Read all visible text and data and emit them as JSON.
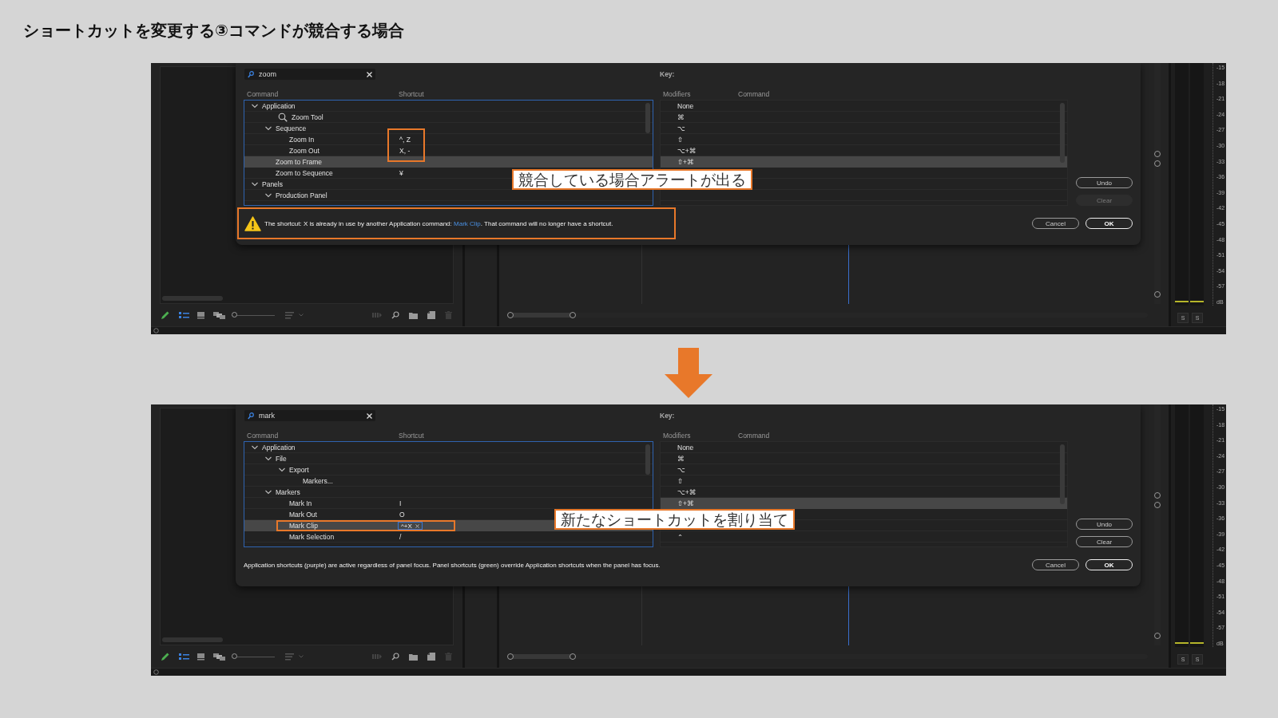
{
  "title": "ショートカットを変更する③コマンドが競合する場合",
  "screens": [
    {
      "search": "zoom",
      "key_label": "Key:",
      "command_columns": [
        "Command",
        "Shortcut"
      ],
      "modifier_columns": [
        "Modifiers",
        "Command"
      ],
      "commands": [
        {
          "label": "Application",
          "selected": false,
          "expanded": true,
          "children": [
            {
              "label": "Zoom Tool",
              "kind": "tool",
              "selected": false
            },
            {
              "label": "Sequence",
              "selected": false,
              "expanded": true,
              "children": [
                {
                  "label": "Zoom In",
                  "shortcut": "^, Z",
                  "shortcut_highlighted": true,
                  "selected": false
                },
                {
                  "label": "Zoom Out",
                  "shortcut": "X, -",
                  "shortcut_highlighted": true,
                  "selected": false
                }
              ]
            },
            {
              "label": "Zoom to Frame",
              "selected": true
            },
            {
              "label": "Zoom to Sequence",
              "shortcut": "¥",
              "selected": false
            }
          ]
        },
        {
          "label": "Panels",
          "selected": false,
          "expanded": true,
          "children": [
            {
              "label": "Production Panel",
              "selected": false,
              "expanded": true
            }
          ]
        }
      ],
      "modifiers": [
        {
          "kind": "modifier",
          "label": "None",
          "selected": false
        },
        {
          "kind": "modifier",
          "label": "⌘",
          "selected": false
        },
        {
          "kind": "modifier",
          "label": "⌥",
          "selected": false
        },
        {
          "kind": "modifier",
          "label": "⇧",
          "selected": false
        },
        {
          "kind": "modifier",
          "label": "⌥+⌘",
          "selected": false
        },
        {
          "kind": "modifier",
          "label": "⇧+⌘",
          "selected": true
        }
      ],
      "side_buttons": [
        {
          "label": "Undo",
          "disabled": false
        },
        {
          "label": "Clear",
          "disabled": true
        }
      ],
      "dialog_buttons": [
        {
          "label": "Cancel",
          "default": false
        },
        {
          "label": "OK",
          "default": true
        }
      ],
      "footer": {
        "kind": "alert",
        "text_before": "The shortcut: X is already in use by another Application command:  ",
        "link": "Mark Clip",
        "text_after": ". That command will no longer have a shortcut."
      },
      "callout": "競合している場合アラートが出る",
      "thumbnail_slider": {
        "level": 0
      },
      "meter_scale": [
        "-15",
        "-18",
        "-21",
        "-24",
        "-27",
        "-30",
        "-33",
        "-36",
        "-39",
        "-42",
        "-45",
        "-48",
        "-51",
        "-54",
        "-57",
        "dB"
      ],
      "meter_buttons": [
        "S",
        "S"
      ]
    },
    {
      "search": "mark",
      "key_label": "Key:",
      "command_columns": [
        "Command",
        "Shortcut"
      ],
      "modifier_columns": [
        "Modifiers",
        "Command"
      ],
      "commands": [
        {
          "label": "Application",
          "selected": false,
          "expanded": true,
          "children": [
            {
              "label": "File",
              "selected": false,
              "expanded": true,
              "children": [
                {
                  "label": "Export",
                  "selected": false,
                  "expanded": true,
                  "children": [
                    {
                      "label": "Markers...",
                      "selected": false
                    }
                  ]
                }
              ]
            },
            {
              "label": "Markers",
              "selected": false,
              "expanded": true,
              "children": [
                {
                  "label": "Mark In",
                  "shortcut": "I",
                  "selected": false
                },
                {
                  "label": "Mark Out",
                  "shortcut": "O",
                  "selected": false
                },
                {
                  "label": "Mark Clip",
                  "shortcut": "^+X",
                  "editing": true,
                  "row_highlighted": true,
                  "selected": true
                },
                {
                  "label": "Mark Selection",
                  "shortcut": "/",
                  "selected": false
                }
              ]
            }
          ]
        }
      ],
      "modifiers": [
        {
          "kind": "modifier",
          "label": "None",
          "selected": false
        },
        {
          "kind": "modifier",
          "label": "⌘",
          "selected": false
        },
        {
          "kind": "modifier",
          "label": "⌥",
          "selected": false
        },
        {
          "kind": "modifier",
          "label": "⇧",
          "selected": false
        },
        {
          "kind": "modifier",
          "label": "⌥+⌘",
          "selected": false
        },
        {
          "kind": "modifier",
          "label": "⇧+⌘",
          "selected": true
        },
        {
          "kind": "blank"
        },
        {
          "kind": "blank"
        },
        {
          "kind": "modifier",
          "label": "⌃",
          "selected": false
        }
      ],
      "side_buttons": [
        {
          "label": "Undo",
          "disabled": false
        },
        {
          "label": "Clear",
          "disabled": false
        }
      ],
      "dialog_buttons": [
        {
          "label": "Cancel",
          "default": false
        },
        {
          "label": "OK",
          "default": true
        }
      ],
      "footer": {
        "kind": "info",
        "text": "Application shortcuts (purple) are active regardless of panel focus. Panel shortcuts (green) override Application shortcuts when the panel has focus."
      },
      "callout": "新たなショートカットを割り当て",
      "thumbnail_slider": {
        "level": 0
      },
      "meter_scale": [
        "-15",
        "-18",
        "-21",
        "-24",
        "-27",
        "-30",
        "-33",
        "-36",
        "-39",
        "-42",
        "-45",
        "-48",
        "-51",
        "-54",
        "-57",
        "dB"
      ],
      "meter_buttons": [
        "S",
        "S"
      ]
    }
  ]
}
